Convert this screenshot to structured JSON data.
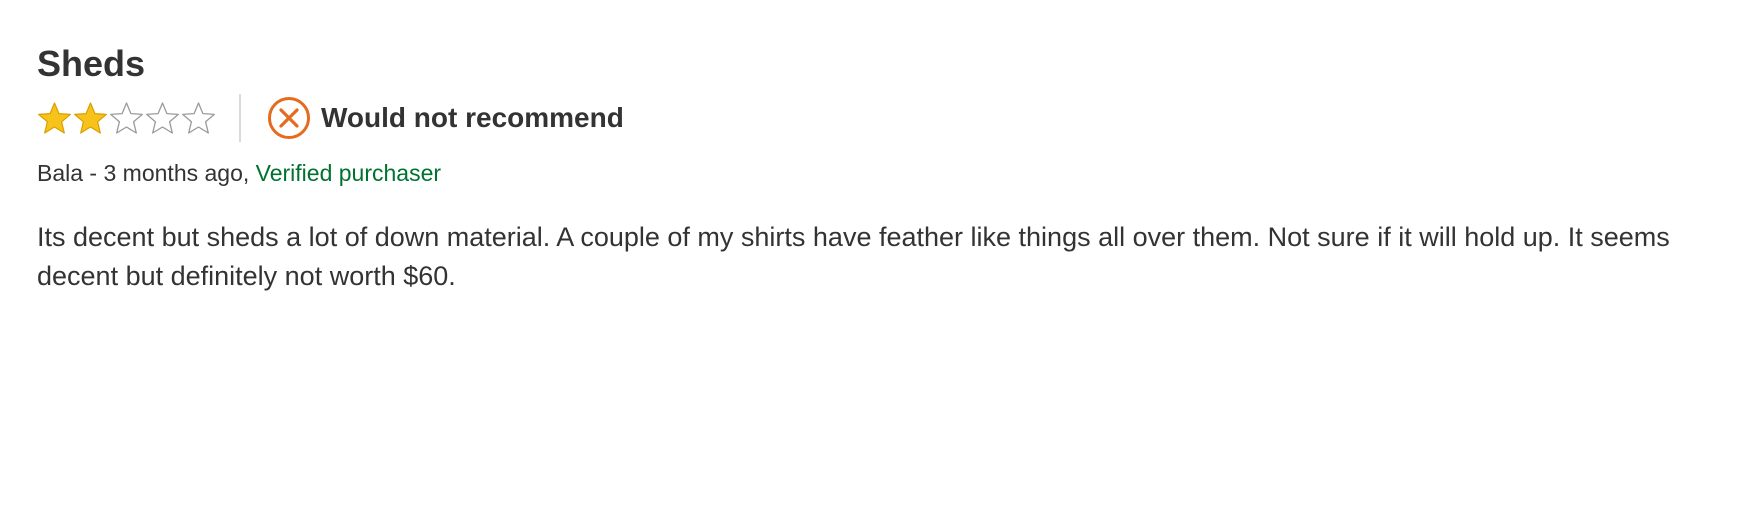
{
  "review": {
    "title": "Sheds",
    "rating": 2,
    "rating_max": 5,
    "recommendation": {
      "label": "Would not recommend",
      "icon": "x-circle-icon",
      "color": "#e56b1f"
    },
    "author": "Bala",
    "separator": " - ",
    "date": "3 months ago",
    "date_suffix": ", ",
    "verified_label": "Verified purchaser",
    "body": "Its decent but sheds a lot of down material. A couple of my shirts have feather like things all over them. Not sure if it will hold up. It seems decent but definitely not worth $60."
  },
  "colors": {
    "star_filled": "#f7c31a",
    "star_empty_outline": "#9a9a9a",
    "verified": "#00722f",
    "text": "#333333"
  }
}
